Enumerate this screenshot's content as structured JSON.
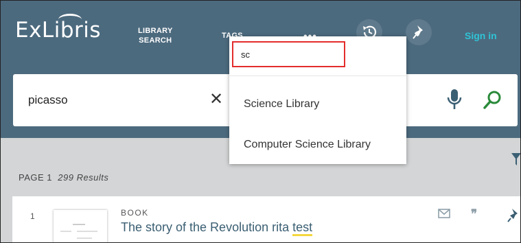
{
  "header": {
    "logo": "ExLibris",
    "nav": [
      {
        "line1": "LIBRARY",
        "line2": "SEARCH"
      },
      {
        "line1": "TAGS"
      }
    ],
    "more": "•••",
    "sign_in": "Sign in"
  },
  "search": {
    "value": "picasso",
    "clear": "✕"
  },
  "scope_dropdown": {
    "filter_value": "sc",
    "options": [
      "Science Library",
      "Computer Science Library"
    ]
  },
  "results": {
    "page_prefix": "PAGE",
    "page_number": "1",
    "count": "299 Results",
    "items": [
      {
        "index": "1",
        "type": "BOOK",
        "title_main": "The story of the Revolution rita ",
        "title_highlight": "test"
      }
    ]
  },
  "colors": {
    "header_bg": "#4c6a7e",
    "signin": "#2fc4d6",
    "highlight_border": "#e32b2b",
    "search_icon": "#2a8a3a",
    "title_link": "#3b5f73"
  },
  "icons": [
    "history-icon",
    "pin-icon",
    "microphone-icon",
    "search-icon",
    "filter-icon",
    "envelope-icon",
    "quote-icon",
    "close-icon"
  ]
}
